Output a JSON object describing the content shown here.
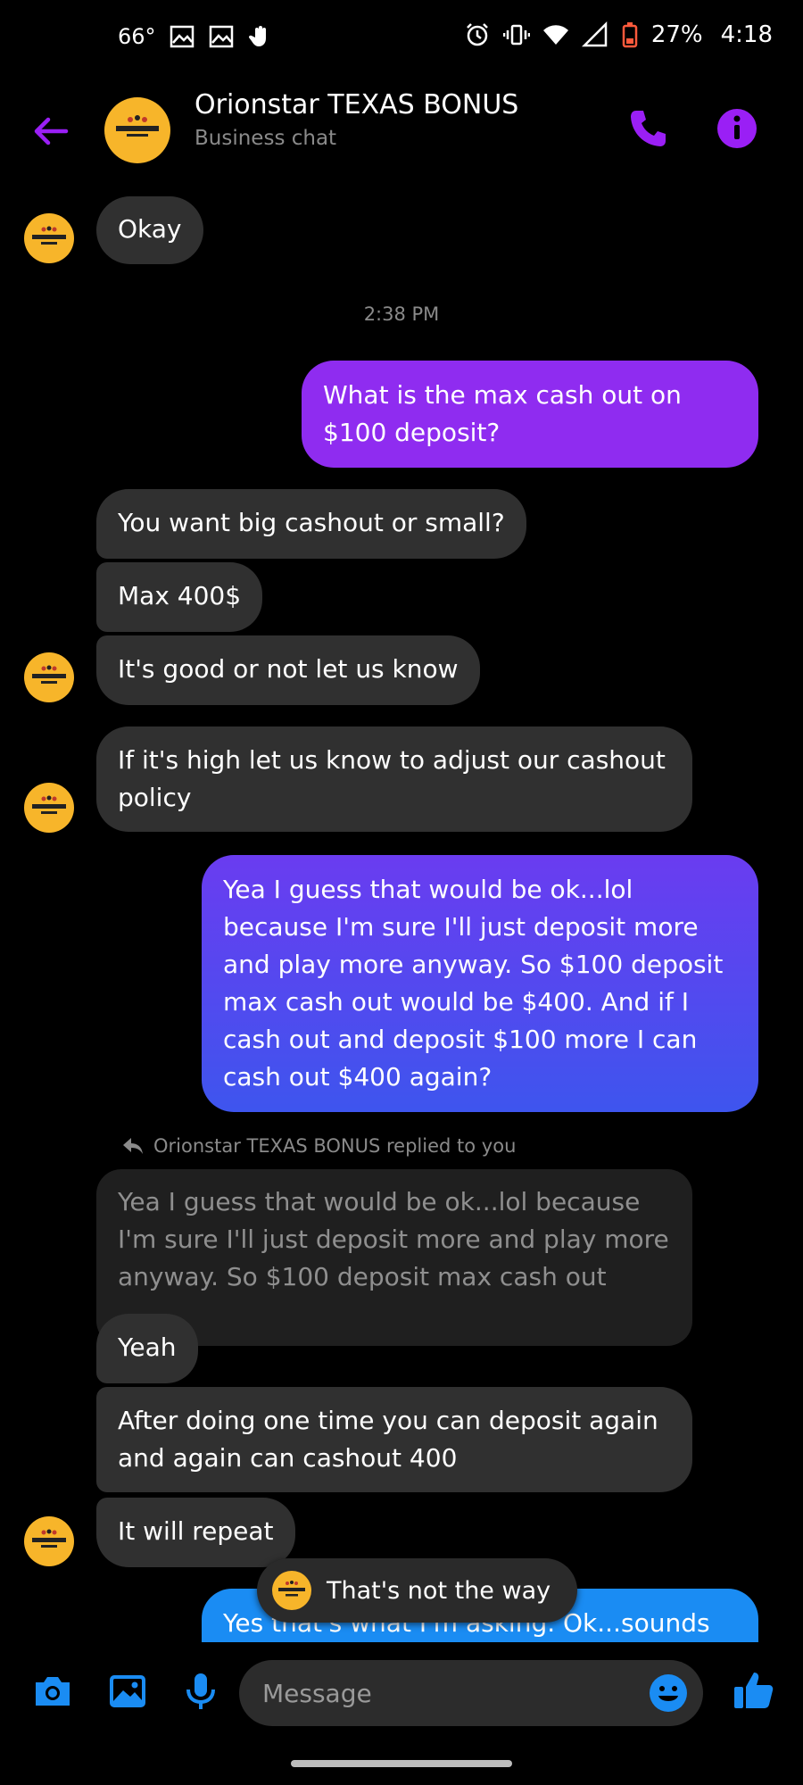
{
  "status_bar": {
    "temperature": "66°",
    "battery": "27%",
    "time": "4:18"
  },
  "header": {
    "title": "Orionstar TEXAS BONUS",
    "subtitle": "Business chat"
  },
  "colors": {
    "accent": "#9a1ff5",
    "incoming_bubble": "#303030",
    "outgoing_purple": "#8f2cf0",
    "outgoing_blue": "#1a8cf3",
    "avatar_yellow": "#f7b52a"
  },
  "messages": [
    {
      "text": "Okay"
    },
    {
      "text": "What is the max cash out on $100 deposit?"
    },
    {
      "text": "You want big cashout or small?"
    },
    {
      "text": "Max 400$"
    },
    {
      "text": "It's good or not let us know"
    },
    {
      "text": "If it's high let us know to adjust our cashout policy"
    },
    {
      "text": "Yea I guess that would be ok...lol because I'm sure I'll just deposit more and play more anyway. So $100 deposit max cash out would be $400. And if I cash out and deposit $100 more I can cash out $400 again?"
    },
    {
      "text": "Yeah"
    },
    {
      "text": "After doing one time you can deposit again and again can cashout 400"
    },
    {
      "text": "It will repeat"
    },
    {
      "text": "Yes that's what I'm asking. Ok...sounds"
    }
  ],
  "timestamp": "2:38 PM",
  "reply": {
    "label": "Orionstar TEXAS BONUS replied to you",
    "quoted_text": "Yea I guess that would be ok...lol because I'm sure I'll just deposit more and play more anyway. So $100 deposit max cash out wo…"
  },
  "toast": {
    "text": "That's not the way"
  },
  "composer": {
    "placeholder": "Message"
  }
}
